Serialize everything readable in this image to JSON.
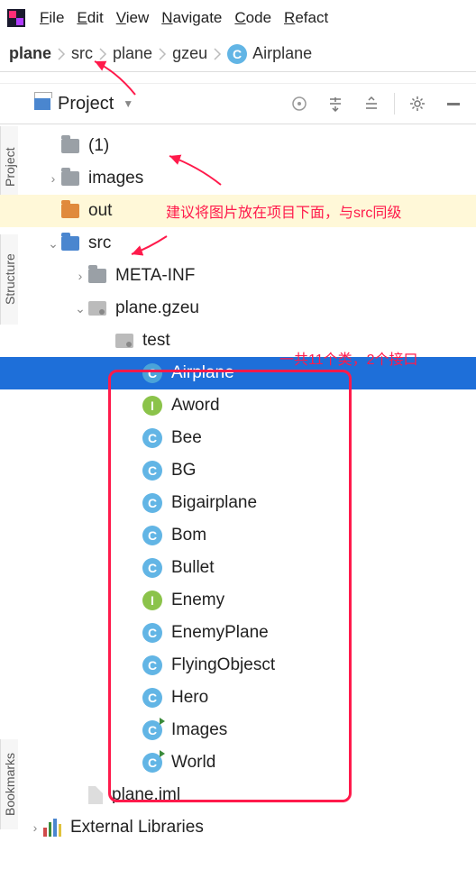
{
  "menu": {
    "file": "File",
    "edit": "Edit",
    "view": "View",
    "navigate": "Navigate",
    "code": "Code",
    "refact": "Refact"
  },
  "breadcrumb": {
    "p0": "plane",
    "p1": "src",
    "p2": "plane",
    "p3": "gzeu",
    "cls": "Airplane"
  },
  "toolbar": {
    "project": "Project"
  },
  "sidetabs": {
    "project": "Project",
    "structure": "Structure",
    "bookmarks": "Bookmarks"
  },
  "tree": {
    "root_suffix": "(1)",
    "images": "images",
    "out": "out",
    "src": "src",
    "meta": "META-INF",
    "pkg": "plane.gzeu",
    "test": "test",
    "iml": "plane.iml",
    "ext": "External Libraries",
    "items": [
      {
        "type": "C",
        "label": "Airplane"
      },
      {
        "type": "I",
        "label": "Aword"
      },
      {
        "type": "C",
        "label": "Bee"
      },
      {
        "type": "C",
        "label": "BG"
      },
      {
        "type": "C",
        "label": "Bigairplane"
      },
      {
        "type": "C",
        "label": "Bom"
      },
      {
        "type": "C",
        "label": "Bullet"
      },
      {
        "type": "I",
        "label": "Enemy"
      },
      {
        "type": "C",
        "label": "EnemyPlane"
      },
      {
        "type": "C",
        "label": "FlyingObjesct"
      },
      {
        "type": "C",
        "label": "Hero"
      },
      {
        "type": "C",
        "label": "Images",
        "flag": true
      },
      {
        "type": "C",
        "label": "World",
        "flag": true
      }
    ]
  },
  "annotations": {
    "note1": "建议将图片放在项目下面，与src同级",
    "note2": "一共11个类，2个接口"
  }
}
